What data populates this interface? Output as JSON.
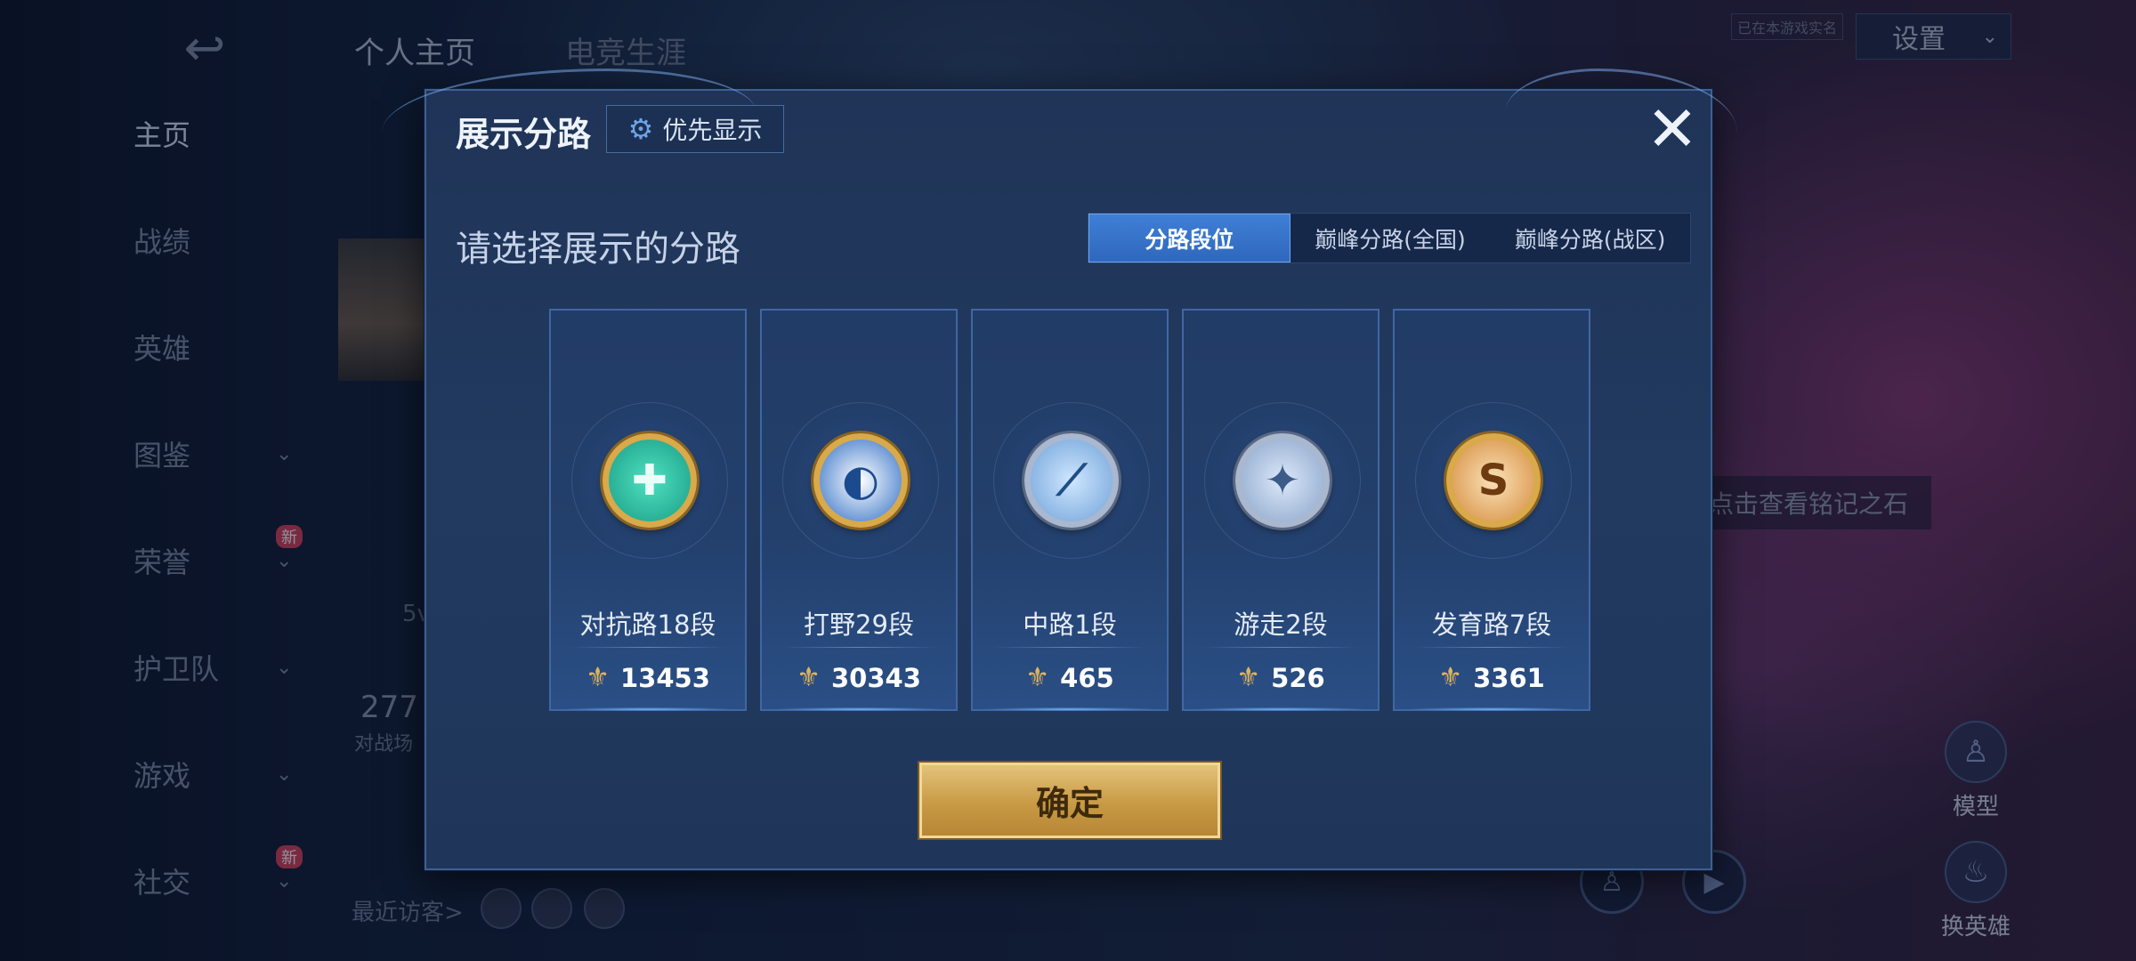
{
  "background": {
    "top_tabs": [
      "个人主页",
      "电竞生涯"
    ],
    "settings_label": "设置",
    "small_tag": "已在本游戏实名",
    "sidebar": [
      {
        "label": "主页",
        "active": true,
        "chevron": false,
        "new": false
      },
      {
        "label": "战绩",
        "active": false,
        "chevron": false,
        "new": false
      },
      {
        "label": "英雄",
        "active": false,
        "chevron": false,
        "new": false
      },
      {
        "label": "图鉴",
        "active": false,
        "chevron": true,
        "new": false
      },
      {
        "label": "荣誉",
        "active": false,
        "chevron": true,
        "new": true
      },
      {
        "label": "护卫队",
        "active": false,
        "chevron": true,
        "new": false
      },
      {
        "label": "游戏",
        "active": false,
        "chevron": true,
        "new": false
      },
      {
        "label": "社交",
        "active": false,
        "chevron": true,
        "new": true
      }
    ],
    "new_badge": "新",
    "rune_hint": "点击查看铭记之石",
    "model_label": "模型",
    "switch_hero_label": "换英雄",
    "recent_visitors_label": "最近访客>",
    "partial_number": "277",
    "partial_text": "对战场",
    "partial_5v": "5v"
  },
  "dialog": {
    "title": "展示分路",
    "priority_button": "优先显示",
    "subtitle": "请选择展示的分路",
    "tabs": [
      {
        "label": "分路段位",
        "active": true
      },
      {
        "label": "巅峰分路(全国)",
        "active": false
      },
      {
        "label": "巅峰分路(战区)",
        "active": false
      }
    ],
    "lanes": [
      {
        "name": "对抗路18段",
        "score": "13453",
        "emblem": "sword-emblem-icon",
        "style": "top gold",
        "glyph": "✚"
      },
      {
        "name": "打野29段",
        "score": "30343",
        "emblem": "dragon-emblem-icon",
        "style": "jungle gold",
        "glyph": "◐"
      },
      {
        "name": "中路1段",
        "score": "465",
        "emblem": "slash-emblem-icon",
        "style": "mid silver",
        "glyph": "⟋"
      },
      {
        "name": "游走2段",
        "score": "526",
        "emblem": "wings-emblem-icon",
        "style": "support silver",
        "glyph": "✦"
      },
      {
        "name": "发育路7段",
        "score": "3361",
        "emblem": "arrow-emblem-icon",
        "style": "adc gold",
        "glyph": "S"
      }
    ],
    "confirm_label": "确定"
  },
  "colors": {
    "accent_tab": "#3f7fd6",
    "confirm_gold": "#c99a45"
  }
}
